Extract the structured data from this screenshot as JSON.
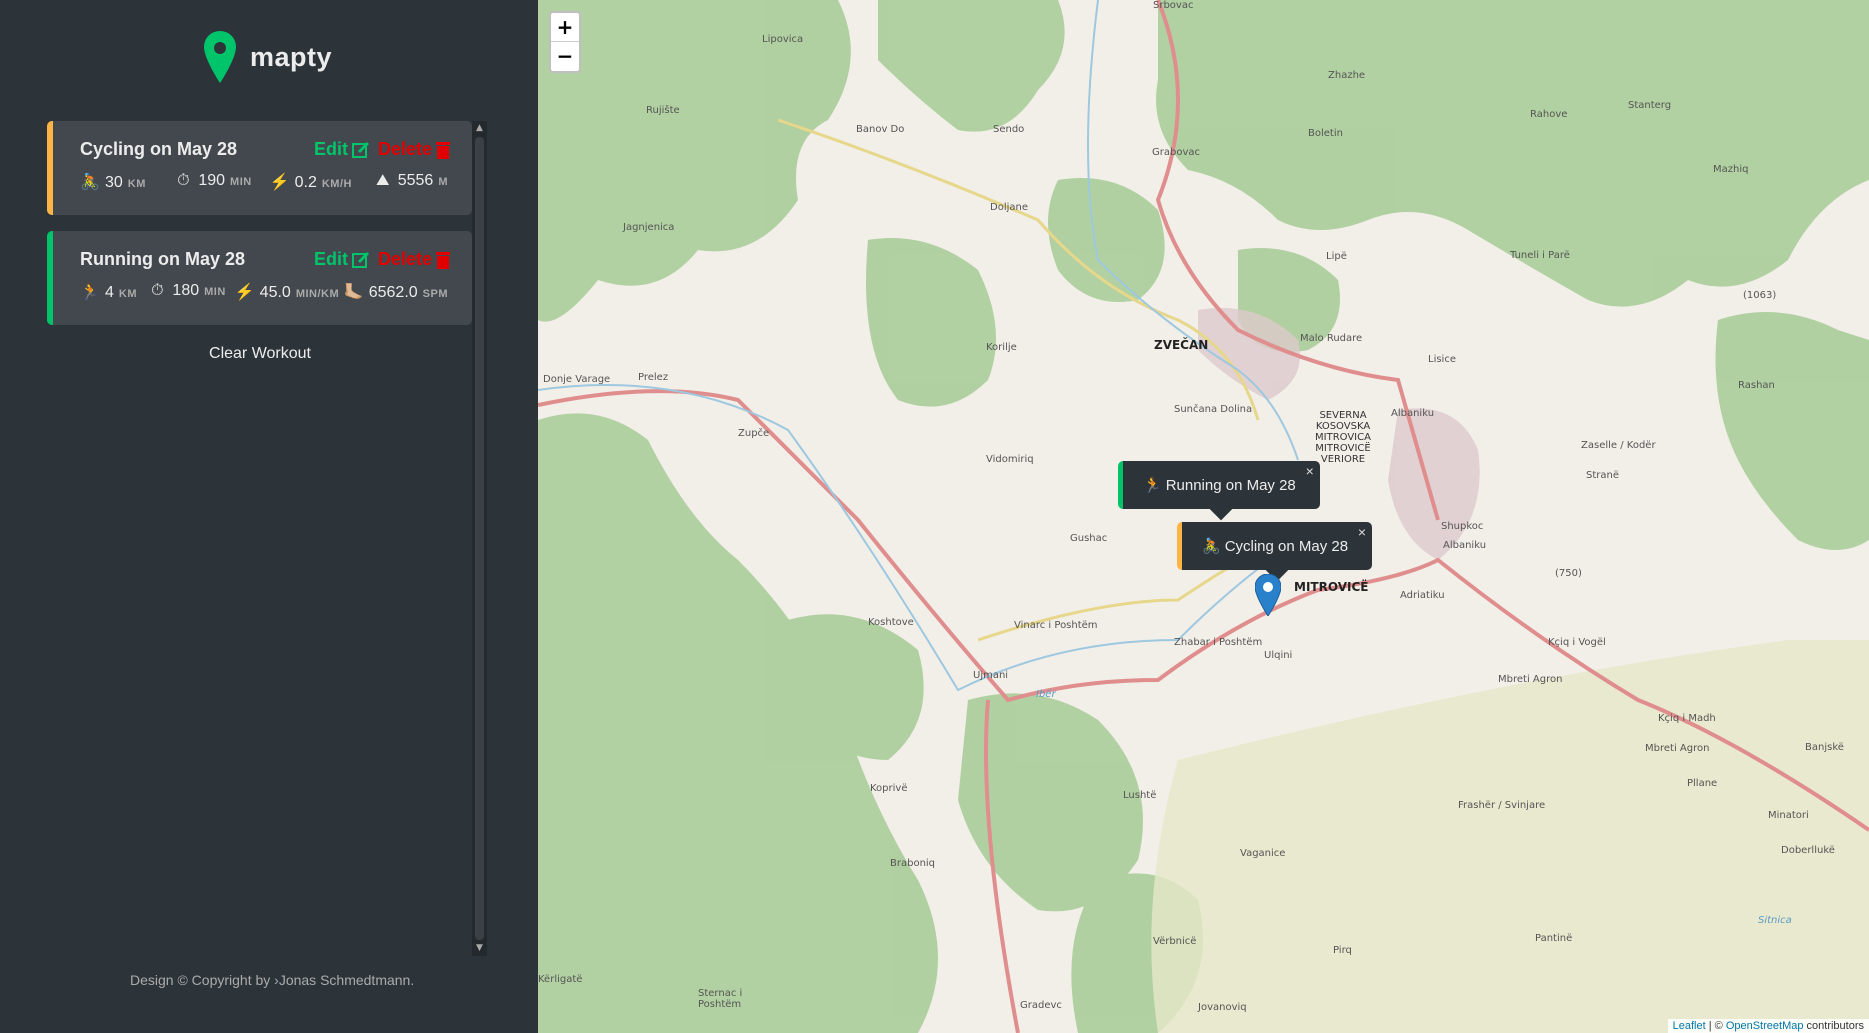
{
  "logo": {
    "text": "mapty"
  },
  "workouts": [
    {
      "type": "cycling",
      "title": "Cycling on May 28",
      "edit_label": "Edit",
      "delete_label": "Delete",
      "stats": [
        {
          "icon": "🚴",
          "value": "30",
          "unit": "km"
        },
        {
          "icon": "⏱",
          "value": "190",
          "unit": "min"
        },
        {
          "icon": "⚡️",
          "value": "0.2",
          "unit": "km/h"
        },
        {
          "icon": "⛰",
          "value": "5556",
          "unit": "m"
        }
      ]
    },
    {
      "type": "running",
      "title": "Running on May 28",
      "edit_label": "Edit",
      "delete_label": "Delete",
      "stats": [
        {
          "icon": "🏃",
          "value": "4",
          "unit": "km"
        },
        {
          "icon": "⏱",
          "value": "180",
          "unit": "min"
        },
        {
          "icon": "⚡️",
          "value": "45.0",
          "unit": "min/km"
        },
        {
          "icon": "🦶🏼",
          "value": "6562.0",
          "unit": "spm"
        }
      ]
    }
  ],
  "clear_label": "Clear Workout",
  "copyright": "Design © Copyright by ›Jonas Schmedtmann.",
  "map": {
    "zoom_in": "+",
    "zoom_out": "−",
    "popups": {
      "running": {
        "icon": "🏃",
        "text": "Running on May 28",
        "close": "×"
      },
      "cycling": {
        "icon": "🚴",
        "text": "Cycling on May 28",
        "close": "×"
      }
    },
    "attribution": {
      "leaflet": "Leaflet",
      "sep": " | © ",
      "osm": "OpenStreetMap",
      "rest": " contributors"
    },
    "labels": {
      "srbovac": "Srbovac",
      "lipovica": "Lipovica",
      "rujiste": "Rujište",
      "banov_do": "Banov Do",
      "sendo": "Sendo",
      "grabovac": "Grabovac",
      "boletin": "Boletin",
      "zhazhe": "Zhazhe",
      "rahove": "Rahove",
      "stanterg": "Stanterg",
      "mazhiq": "Mazhiq",
      "jagnjenica": "Jagnjenica",
      "doljane": "Doljane",
      "lipe": "Lipë",
      "tuneli": "Tuneli i Parë",
      "h1063": "(1063)",
      "korilje": "Korilje",
      "zvecan": "ZVEČAN",
      "malo_rudare": "Malo Rudare",
      "lisice": "Lisice",
      "rashan": "Rashan",
      "donje_varage": "Donje Varage",
      "prelez": "Prelez",
      "zupce": "Zupče",
      "suncana": "Sunčana Dolina",
      "severna": "SEVERNA KOSOVSKA MITROVICA MITROVICË VERIORE",
      "albaniku1": "Albaniku",
      "zaselle": "Zaselle / Kodër",
      "vidomiriq": "Vidomiriq",
      "strane": "Stranë",
      "shupkoc": "Shupkoc",
      "gushac": "Gushac",
      "albaniku2": "Albaniku",
      "mitrovice": "MITROVICË",
      "adriatiku": "Adriatiku",
      "h750": "(750)",
      "koshtove": "Koshtove",
      "vinarc": "Vinarc i Poshtëm",
      "zhabar": "Zhabar i Poshtëm",
      "ulqini": "Ulqini",
      "kciq": "Kçiq i Vogël",
      "ujmani": "Ujmani",
      "iber": "Ibër",
      "mbreti_agron1": "Mbreti Agron",
      "kciq_madh": "Kçiq i Madh",
      "banjske": "Banjskë",
      "mbreti_agron2": "Mbreti Agron",
      "pllane": "Pllane",
      "koprive": "Koprivë",
      "lushte": "Lushtë",
      "frasher": "Frashër / Svinjare",
      "minatori": "Minatori",
      "braboniq": "Braboniq",
      "vaganice": "Vaganice",
      "doberlluke": "Doberllukë",
      "sitnica": "Sitnica",
      "verbnice": "Vërbnicë",
      "pirq": "Pirq",
      "pantine": "Pantinë",
      "kerligate": "Kërligatë",
      "sternac": "Sternac i Poshtëm",
      "gradevc": "Gradevc",
      "jovanoviq": "Jovanoviq"
    }
  }
}
